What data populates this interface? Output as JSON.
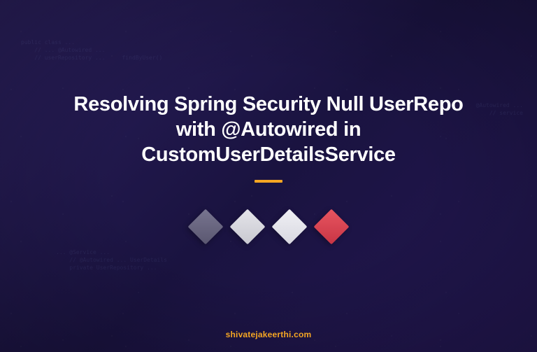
{
  "title": "Resolving Spring Security Null UserRepo with @Autowired in CustomUserDetailsService",
  "footer_url": "shivatejakeerthi.com",
  "colors": {
    "accent": "#f5a623",
    "background_start": "#2a1f5c",
    "background_end": "#1a1340",
    "diamond1": "#787590",
    "diamond2": "#e5e5ea",
    "diamond3": "#f0f0f5",
    "diamond4": "#e85560"
  },
  "bg_code": {
    "snippet1": "public class ...\n    // ... @Autowired ...\n    // userRepository ...     findByUser()",
    "snippet2": "... @Service ...\n    // @Autowired ... UserDetails\n    private UserRepository ...",
    "snippet3": "@Autowired ...\n// service"
  }
}
